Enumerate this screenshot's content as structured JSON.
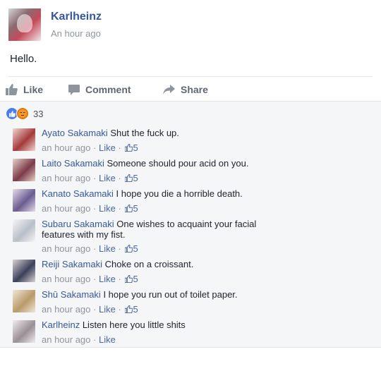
{
  "post": {
    "author": "Karlheinz",
    "time": "An hour ago",
    "text": "Hello."
  },
  "actions": {
    "like": "Like",
    "comment": "Comment",
    "share": "Share"
  },
  "reactions": {
    "icons": [
      "like-reaction",
      "angry-reaction"
    ],
    "count": "33"
  },
  "colors": {
    "link": "#365899",
    "meta": "#90949c",
    "comment_bg": "#f5f6f7",
    "like_reaction": "#4a7ef2",
    "angry_reaction": "#e9710f"
  },
  "comments": [
    {
      "name": "Ayato Sakamaki",
      "text": "Shut the fuck up.",
      "time": "an hour ago",
      "sep": "·",
      "like": "Like",
      "likes": "5"
    },
    {
      "name": "Laito Sakamaki",
      "text": "Someone should pour acid on you.",
      "time": "an hour ago",
      "sep": "·",
      "like": "Like",
      "likes": "5"
    },
    {
      "name": "Kanato Sakamaki",
      "text": "I hope you die a horrible death.",
      "time": "an hour ago",
      "sep": "·",
      "like": "Like",
      "likes": "5"
    },
    {
      "name": "Subaru Sakamaki",
      "text": "One wishes to acquaint your facial features with my fist.",
      "time": "an hour ago",
      "sep": "·",
      "like": "Like",
      "likes": "5"
    },
    {
      "name": "Reiji Sakamaki",
      "text": "Choke on a croissant.",
      "time": "an hour ago",
      "sep": "·",
      "like": "Like",
      "likes": "5"
    },
    {
      "name": "Shū Sakamaki",
      "text": "I hope you run out of toilet paper.",
      "time": "an hour ago",
      "sep": "·",
      "like": "Like",
      "likes": "5"
    },
    {
      "name": "Karlheinz",
      "text": "Listen here you little shits",
      "time": "an hour ago",
      "sep": "·",
      "like": "Like",
      "likes": null
    }
  ]
}
